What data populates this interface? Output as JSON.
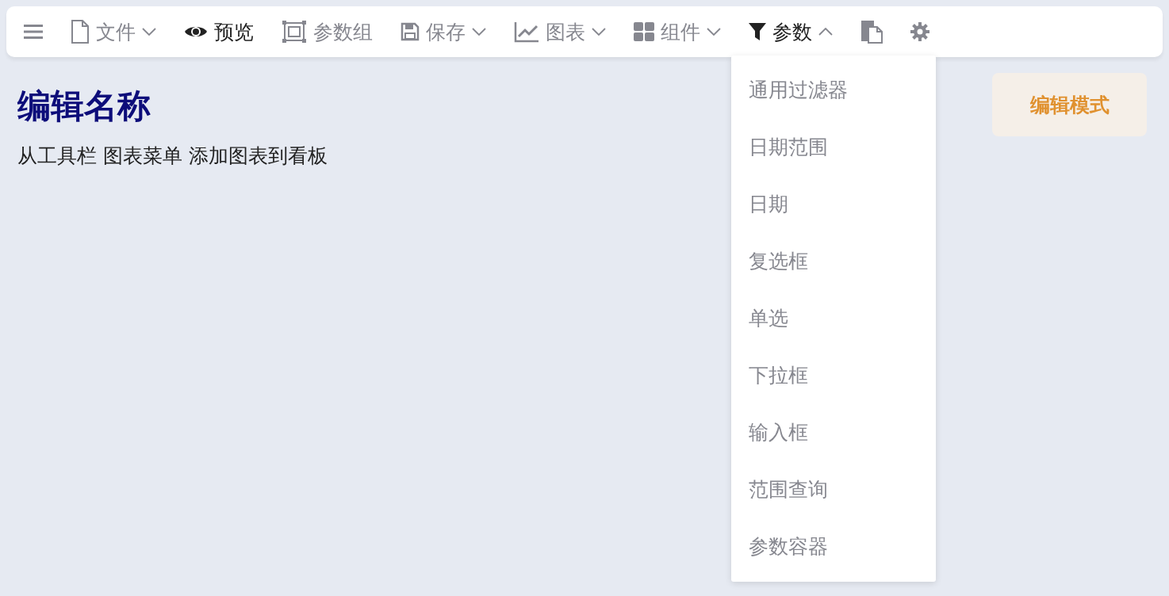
{
  "toolbar": {
    "items": [
      {
        "kind": "icon"
      },
      {
        "kind": "dropdown",
        "label": "文件",
        "expanded": false
      },
      {
        "kind": "button",
        "label": "预览",
        "active": true
      },
      {
        "kind": "button",
        "label": "参数组",
        "active": false
      },
      {
        "kind": "dropdown",
        "label": "保存",
        "expanded": false
      },
      {
        "kind": "dropdown",
        "label": "图表",
        "expanded": false
      },
      {
        "kind": "dropdown",
        "label": "组件",
        "expanded": false
      },
      {
        "kind": "dropdown",
        "label": "参数",
        "expanded": true,
        "menu": [
          "通用过滤器",
          "日期范围",
          "日期",
          "复选框",
          "单选",
          "下拉框",
          "输入框",
          "范围查询",
          "参数容器"
        ]
      },
      {
        "kind": "icon"
      },
      {
        "kind": "icon"
      }
    ]
  },
  "page": {
    "title": "编辑名称",
    "hint": "从工具栏 图表菜单 添加图表到看板",
    "mode_button": "编辑模式"
  }
}
